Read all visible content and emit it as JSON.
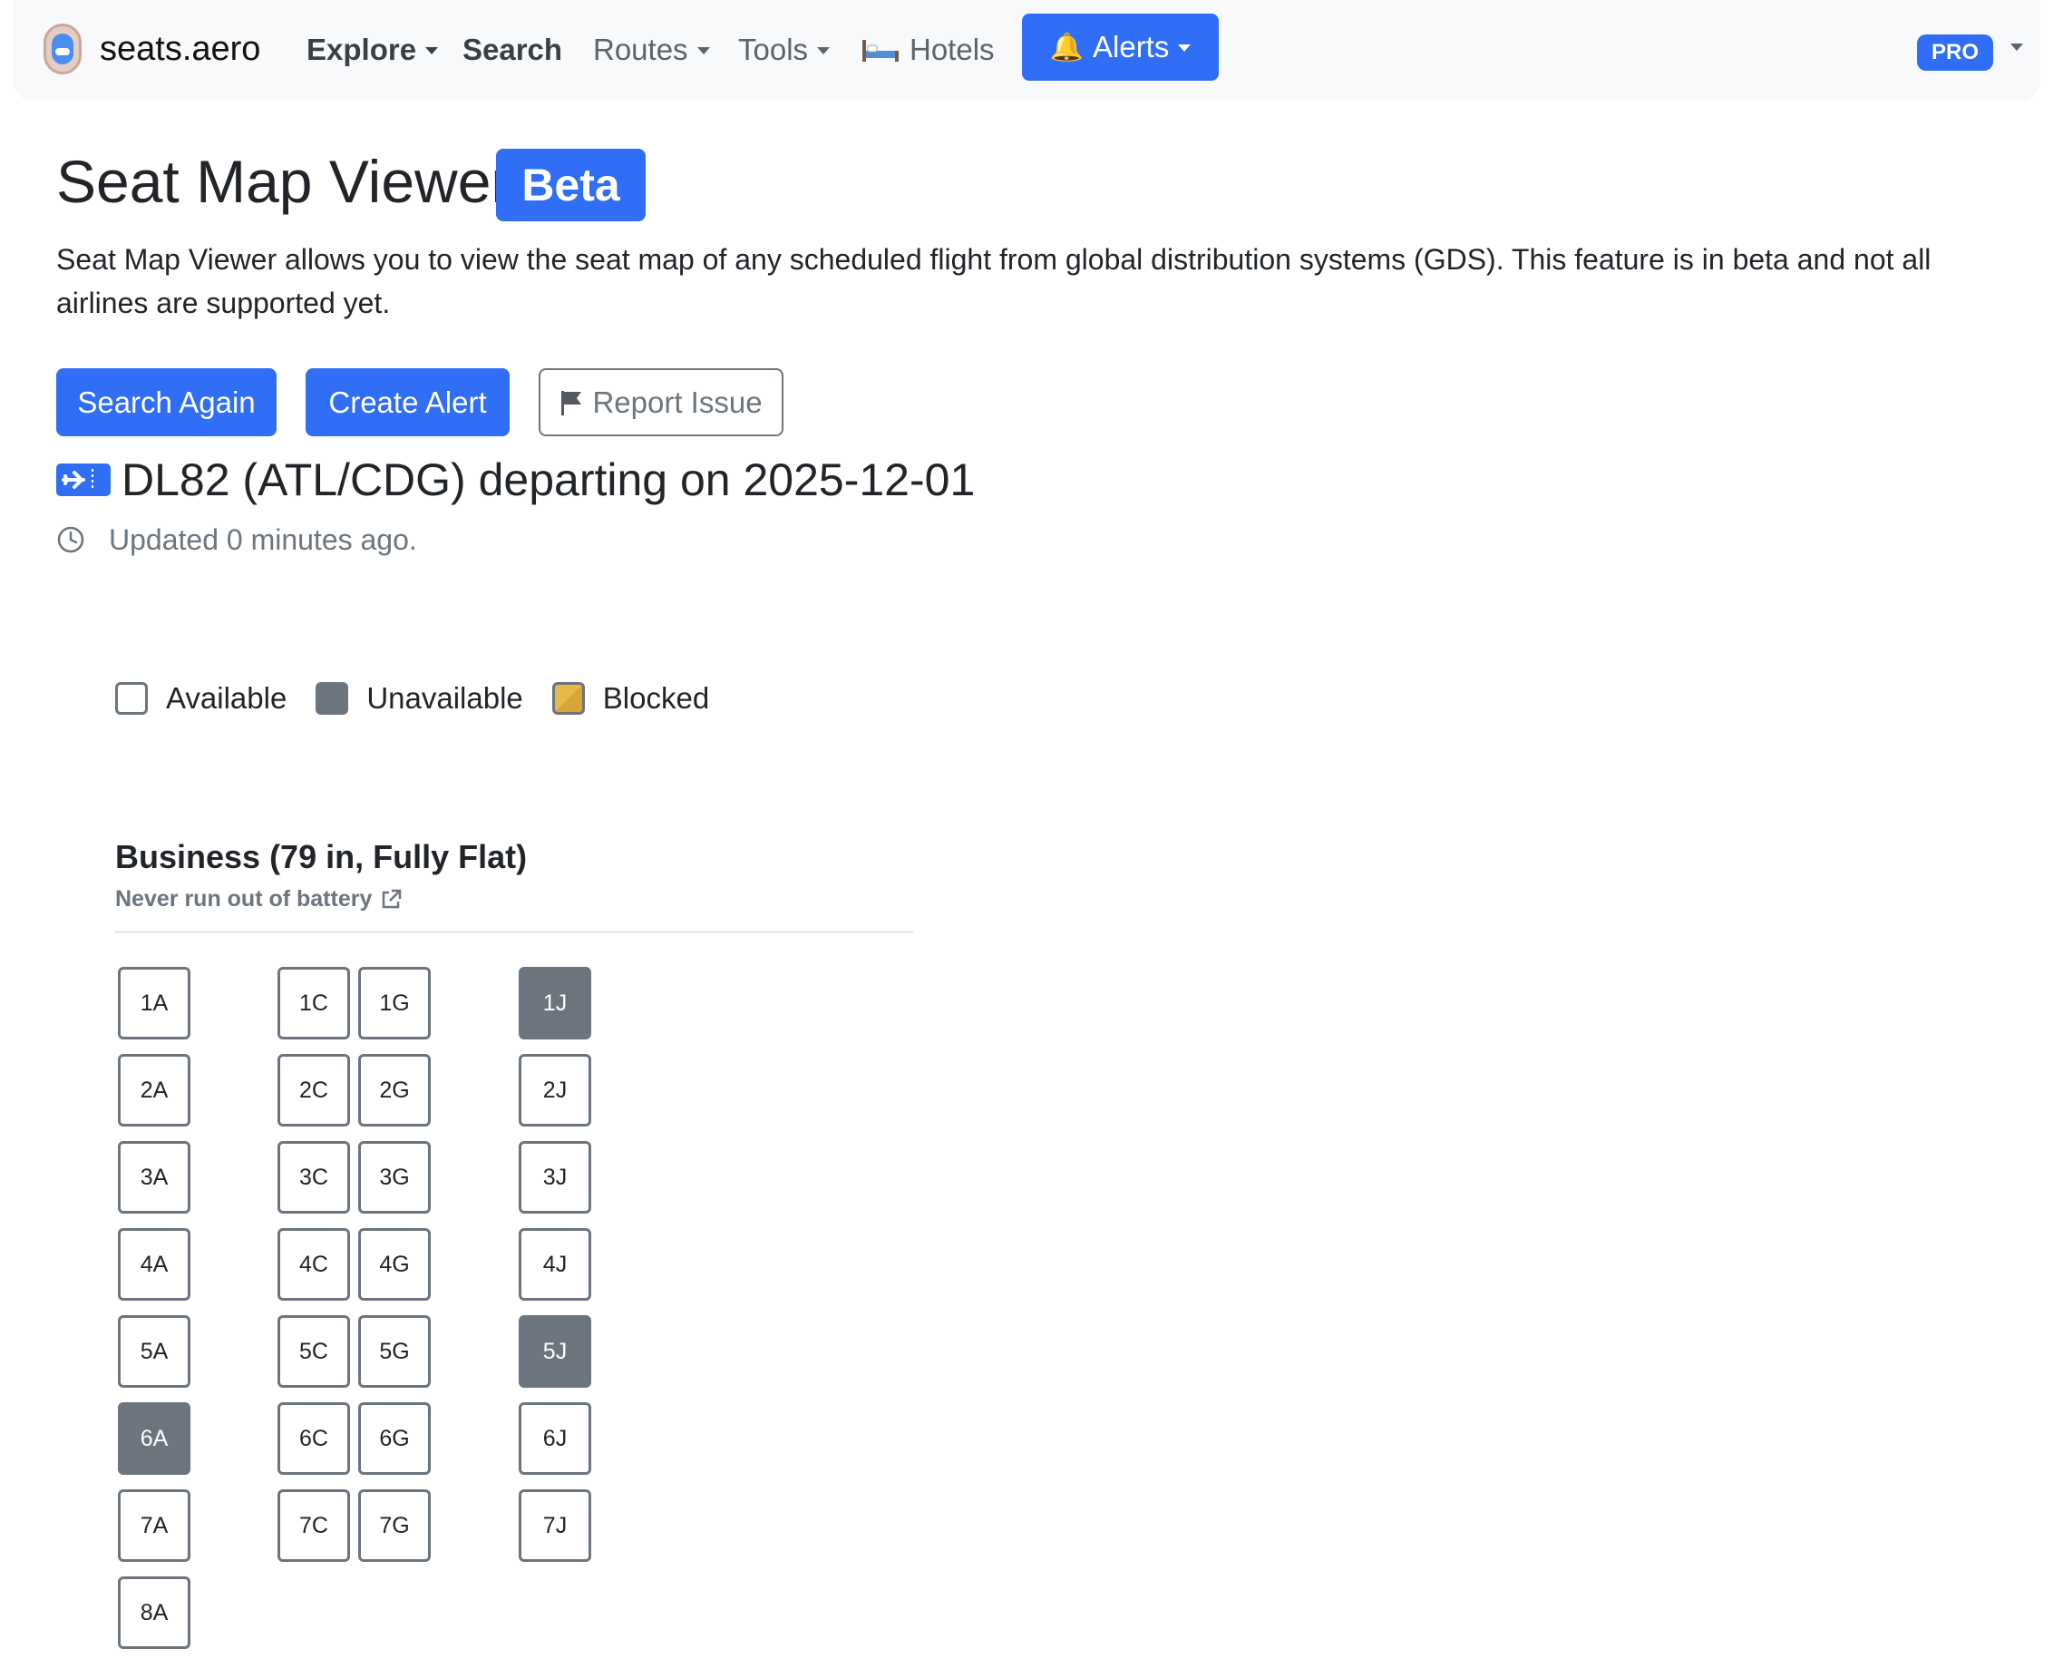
{
  "navbar": {
    "brand": "seats.aero",
    "items": [
      {
        "label": "Explore",
        "dropdown": true
      },
      {
        "label": "Search",
        "dropdown": false
      },
      {
        "label": "Routes",
        "dropdown": true
      },
      {
        "label": "Tools",
        "dropdown": true
      },
      {
        "label": "Hotels",
        "icon": "bed-icon"
      }
    ],
    "alerts_label": "Alerts",
    "pro_badge": "PRO"
  },
  "header": {
    "title": "Seat Map Viewer",
    "badge": "Beta",
    "description": "Seat Map Viewer allows you to view the seat map of any scheduled flight from global distribution systems (GDS). This feature is in beta and not all airlines are supported yet."
  },
  "actions": {
    "search_again": "Search Again",
    "create_alert": "Create Alert",
    "report_issue": "Report Issue"
  },
  "flight": {
    "title": "DL82 (ATL/CDG) departing on 2025-12-01",
    "updated": "Updated 0 minutes ago."
  },
  "legend": {
    "available": "Available",
    "unavailable": "Unavailable",
    "blocked": "Blocked"
  },
  "cabin": {
    "name": "Business (79 in, Fully Flat)",
    "subtitle": "Never run out of battery",
    "seats": [
      {
        "label": "1A",
        "row": 1,
        "col": "A",
        "status": "available"
      },
      {
        "label": "1C",
        "row": 1,
        "col": "C",
        "status": "available"
      },
      {
        "label": "1G",
        "row": 1,
        "col": "G",
        "status": "available"
      },
      {
        "label": "1J",
        "row": 1,
        "col": "J",
        "status": "unavailable"
      },
      {
        "label": "2A",
        "row": 2,
        "col": "A",
        "status": "available"
      },
      {
        "label": "2C",
        "row": 2,
        "col": "C",
        "status": "available"
      },
      {
        "label": "2G",
        "row": 2,
        "col": "G",
        "status": "available"
      },
      {
        "label": "2J",
        "row": 2,
        "col": "J",
        "status": "available"
      },
      {
        "label": "3A",
        "row": 3,
        "col": "A",
        "status": "available"
      },
      {
        "label": "3C",
        "row": 3,
        "col": "C",
        "status": "available"
      },
      {
        "label": "3G",
        "row": 3,
        "col": "G",
        "status": "available"
      },
      {
        "label": "3J",
        "row": 3,
        "col": "J",
        "status": "available"
      },
      {
        "label": "4A",
        "row": 4,
        "col": "A",
        "status": "available"
      },
      {
        "label": "4C",
        "row": 4,
        "col": "C",
        "status": "available"
      },
      {
        "label": "4G",
        "row": 4,
        "col": "G",
        "status": "available"
      },
      {
        "label": "4J",
        "row": 4,
        "col": "J",
        "status": "available"
      },
      {
        "label": "5A",
        "row": 5,
        "col": "A",
        "status": "available"
      },
      {
        "label": "5C",
        "row": 5,
        "col": "C",
        "status": "available"
      },
      {
        "label": "5G",
        "row": 5,
        "col": "G",
        "status": "available"
      },
      {
        "label": "5J",
        "row": 5,
        "col": "J",
        "status": "unavailable"
      },
      {
        "label": "6A",
        "row": 6,
        "col": "A",
        "status": "unavailable"
      },
      {
        "label": "6C",
        "row": 6,
        "col": "C",
        "status": "available"
      },
      {
        "label": "6G",
        "row": 6,
        "col": "G",
        "status": "available"
      },
      {
        "label": "6J",
        "row": 6,
        "col": "J",
        "status": "available"
      },
      {
        "label": "7A",
        "row": 7,
        "col": "A",
        "status": "available"
      },
      {
        "label": "7C",
        "row": 7,
        "col": "C",
        "status": "available"
      },
      {
        "label": "7G",
        "row": 7,
        "col": "G",
        "status": "available"
      },
      {
        "label": "7J",
        "row": 7,
        "col": "J",
        "status": "available"
      },
      {
        "label": "8A",
        "row": 8,
        "col": "A",
        "status": "available"
      }
    ]
  },
  "colors": {
    "primary": "#2f6ef5",
    "unavailable": "#6c757d",
    "blocked": "#e7b84a",
    "navbar_bg": "#f8f9fa"
  }
}
